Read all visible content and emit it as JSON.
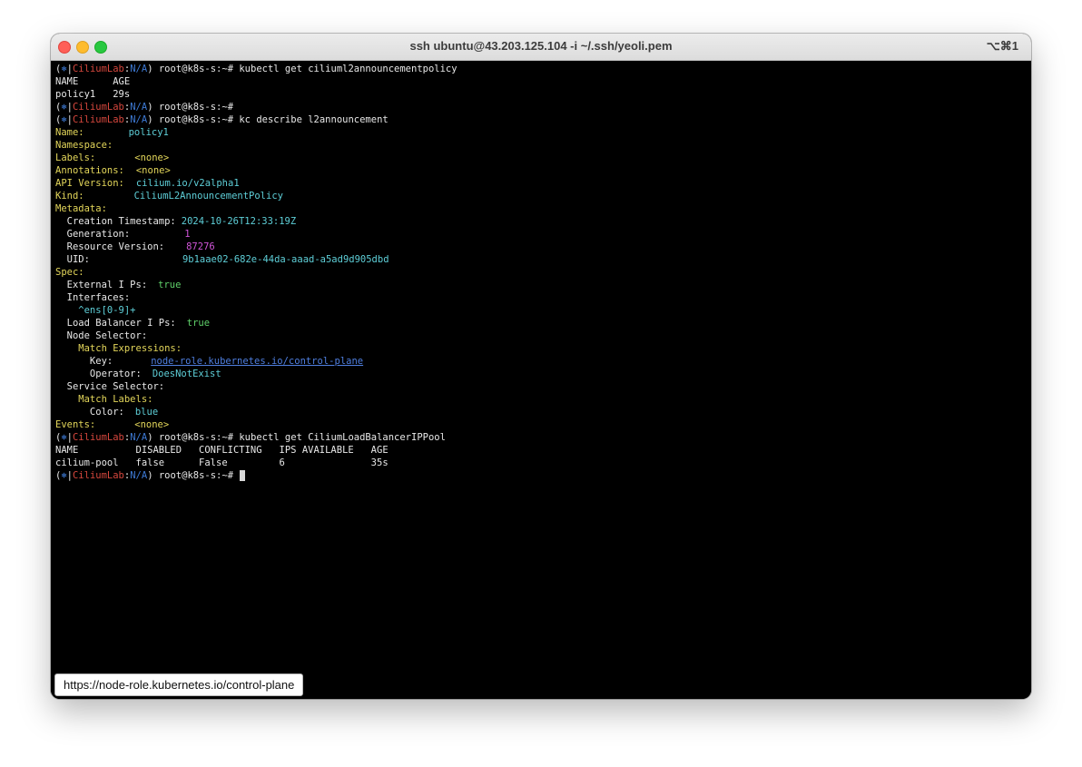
{
  "window": {
    "title": "ssh ubuntu@43.203.125.104 -i ~/.ssh/yeoli.pem",
    "shortcut": "⌥⌘1"
  },
  "prompt": {
    "open": "(",
    "helm": "⎈",
    "sep": "|",
    "cluster": "CiliumLab",
    "colon": ":",
    "namespace": "N/A",
    "close": ")",
    "user_host": " root@k8s-s:~#"
  },
  "terminal": {
    "cmd1": " kubectl get ciliuml2announcementpolicy",
    "out1_header": "NAME      AGE",
    "out1_row": "policy1   29s",
    "cmd2": "",
    "cmd3": " kc describe l2announcement",
    "describe": {
      "name_key": "Name:",
      "name_val": "policy1",
      "namespace_key": "Namespace:",
      "labels_key": "Labels:",
      "labels_val": "<none>",
      "annotations_key": "Annotations:",
      "annotations_val": "<none>",
      "api_key": "API Version:",
      "api_val": "cilium.io/v2alpha1",
      "kind_key": "Kind:",
      "kind_val": "CiliumL2AnnouncementPolicy",
      "metadata_key": "Metadata:",
      "creation_key": "  Creation Timestamp:",
      "creation_val": "2024-10-26T12:33:19Z",
      "generation_key": "  Generation:",
      "generation_val": "1",
      "resource_key": "  Resource Version:",
      "resource_val": "87276",
      "uid_key": "  UID:",
      "uid_val": "9b1aae02-682e-44da-aaad-a5ad9d905dbd",
      "spec_key": "Spec:",
      "external_key": "  External I Ps:",
      "external_val": "true",
      "interfaces_key": "  Interfaces:",
      "interfaces_val": "    ^ens[0-9]+",
      "lb_key": "  Load Balancer I Ps:",
      "lb_val": "true",
      "node_selector_key": "  Node Selector:",
      "match_expr_key": "    Match Expressions:",
      "key_key": "      Key:",
      "key_val": "node-role.kubernetes.io/control-plane",
      "operator_key": "      Operator:",
      "operator_val": "DoesNotExist",
      "service_selector_key": "  Service Selector:",
      "match_labels_key": "    Match Labels:",
      "color_key": "      Color:",
      "color_val": "blue",
      "events_key": "Events:",
      "events_val": "<none>"
    },
    "cmd4": " kubectl get CiliumLoadBalancerIPPool",
    "out4_header": "NAME          DISABLED   CONFLICTING   IPS AVAILABLE   AGE",
    "out4_row": "cilium-pool   false      False         6               35s",
    "cmd5": " "
  },
  "tooltip": {
    "text": "https://node-role.kubernetes.io/control-plane"
  },
  "colors": {
    "prompt_bracket": "#3e7bd6",
    "prompt_cluster": "#d6473d",
    "key_yellow": "#e3d65a",
    "value_cyan": "#5ecfd8",
    "bool_green": "#5fd16a",
    "number_magenta": "#d055d8"
  }
}
